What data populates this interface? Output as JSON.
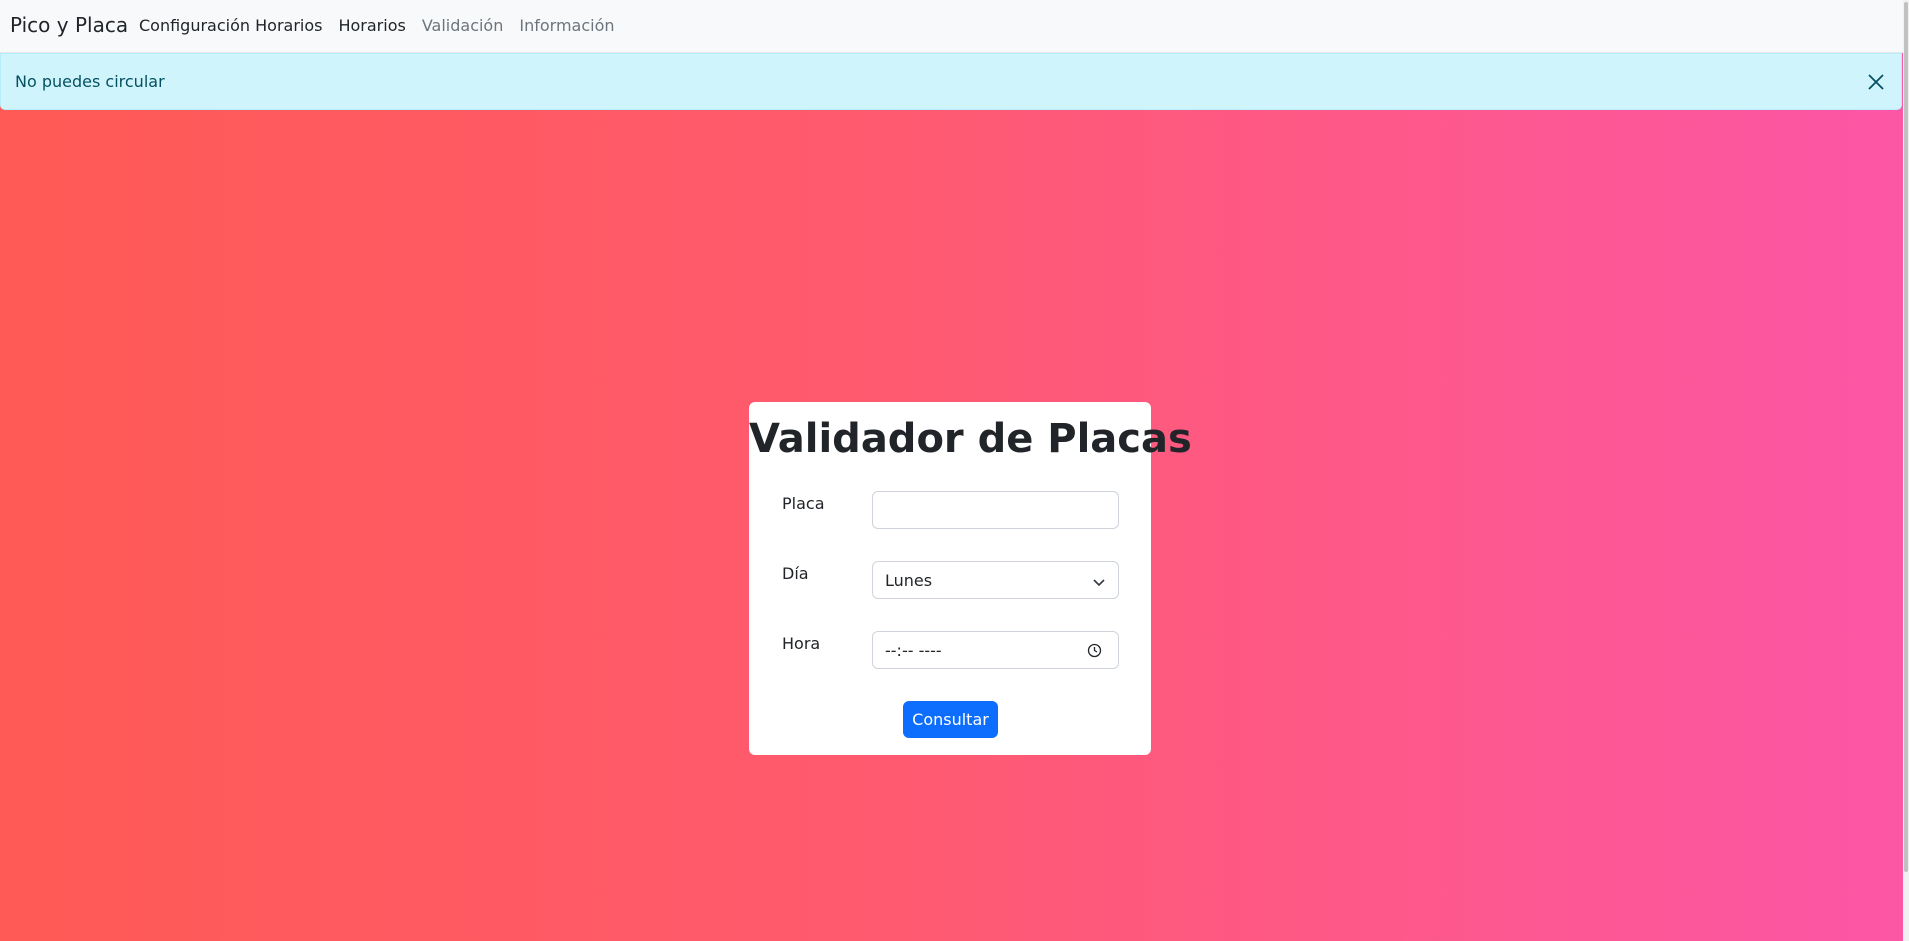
{
  "navbar": {
    "brand": "Pico y Placa",
    "links": [
      {
        "label": "Configuración Horarios",
        "active": true
      },
      {
        "label": "Horarios",
        "active": true
      },
      {
        "label": "Validación",
        "active": false
      },
      {
        "label": "Información",
        "active": false
      }
    ]
  },
  "alert": {
    "message": "No puedes circular",
    "close_icon": "close-icon"
  },
  "form": {
    "title": "Validador de Placas",
    "placa_label": "Placa",
    "placa_value": "",
    "dia_label": "Día",
    "dia_selected": "Lunes",
    "hora_label": "Hora",
    "hora_value": "--:-- ----",
    "submit_label": "Consultar"
  },
  "colors": {
    "gradient_start": "#ff5a55",
    "gradient_end": "#fc56a6",
    "alert_bg": "#cff4fc",
    "alert_text": "#055160",
    "primary_button": "#0d6efd"
  }
}
